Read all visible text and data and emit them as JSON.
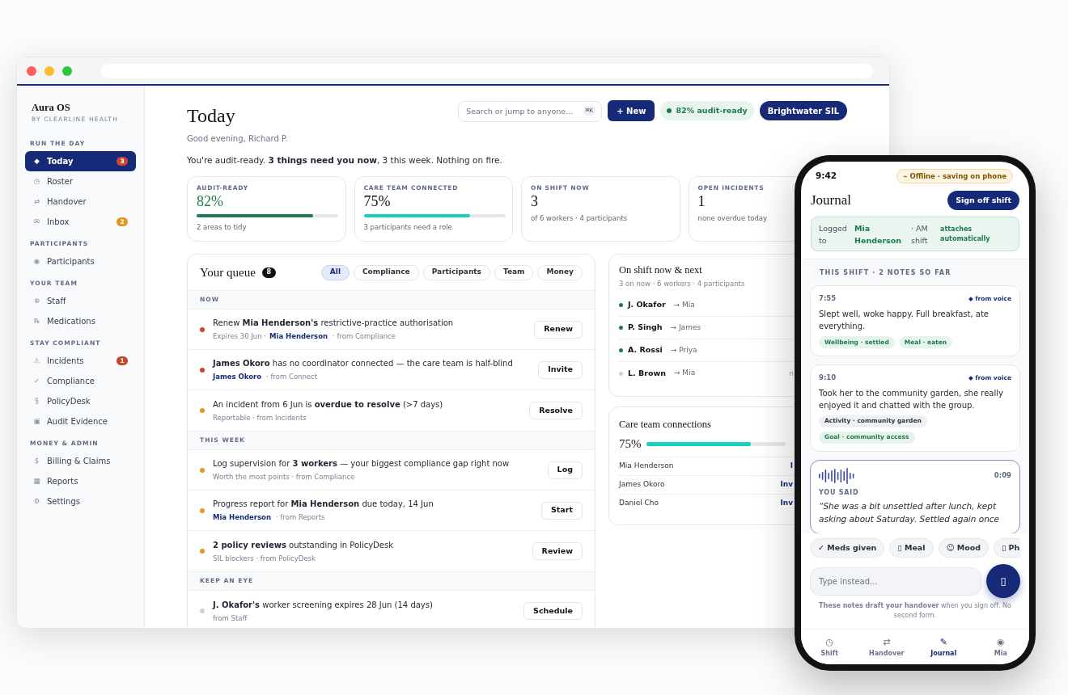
{
  "sidebar": {
    "brand": "Aura OS",
    "subtitle": "BY CLEARLINE HEALTH",
    "sections": [
      {
        "heading": "RUN THE DAY",
        "items": [
          {
            "icon": "◆",
            "label": "Today",
            "selected": true,
            "badge": "3",
            "color": "#c8472f"
          },
          {
            "icon": "◷",
            "label": "Roster",
            "selected": false
          },
          {
            "icon": "⇄",
            "label": "Handover",
            "selected": false
          },
          {
            "icon": "✉",
            "label": "Inbox",
            "selected": false,
            "badge": "2",
            "color": "#dc9a22"
          }
        ]
      },
      {
        "heading": "PARTICIPANTS",
        "items": [
          {
            "icon": "◉",
            "label": "Participants",
            "selected": false
          }
        ]
      },
      {
        "heading": "YOUR TEAM",
        "items": [
          {
            "icon": "⊕",
            "label": "Staff",
            "selected": false
          },
          {
            "icon": "℞",
            "label": "Medications",
            "selected": false
          }
        ]
      },
      {
        "heading": "STAY COMPLIANT",
        "items": [
          {
            "icon": "⚠",
            "label": "Incidents",
            "selected": false,
            "badge": "1",
            "color": "#c8472f"
          },
          {
            "icon": "✓",
            "label": "Compliance",
            "selected": false
          },
          {
            "icon": "§",
            "label": "PolicyDesk",
            "selected": false
          },
          {
            "icon": "▣",
            "label": "Audit Evidence",
            "selected": false
          }
        ]
      },
      {
        "heading": "MONEY & ADMIN",
        "items": [
          {
            "icon": "$",
            "label": "Billing & Claims",
            "selected": false
          },
          {
            "icon": "▦",
            "label": "Reports",
            "selected": false
          },
          {
            "icon": "⚙",
            "label": "Settings",
            "selected": false
          }
        ]
      }
    ]
  },
  "header": {
    "title": "Today",
    "greeting": "Good evening, Richard P.",
    "summary": "You're audit-ready. **3 things need you now**, 3 this week. Nothing on fire.",
    "search": {
      "placeholder": "Search or jump to anyone...",
      "shortcut": "⌘K"
    },
    "new_button": "+ New",
    "audit_status": "82% audit-ready",
    "org_button": "Brightwater SIL"
  },
  "stats": [
    {
      "label": "AUDIT-READY",
      "value": "82%",
      "highlight": true,
      "level": 0.82,
      "color": "#1e7a4f",
      "note": "2 areas to tidy"
    },
    {
      "label": "CARE TEAM CONNECTED",
      "value": "75%",
      "highlight": false,
      "level": 0.75,
      "color": "#14d3b8",
      "note": "3 participants need a role"
    },
    {
      "label": "ON SHIFT NOW",
      "value": "3",
      "highlight": false,
      "note": "of 6 workers · 4 participants"
    },
    {
      "label": "OPEN INCIDENTS",
      "value": "1",
      "highlight": false,
      "note": "none overdue today"
    }
  ],
  "queue": {
    "title": "Your queue",
    "count": "8",
    "filters": [
      {
        "label": "All",
        "selected": true
      },
      {
        "label": "Compliance",
        "selected": false
      },
      {
        "label": "Participants",
        "selected": false
      },
      {
        "label": "Team",
        "selected": false
      },
      {
        "label": "Money",
        "selected": false
      }
    ],
    "groups": [
      {
        "heading": "NOW",
        "items": [
          {
            "color": "#c8472f",
            "title": "Renew **Mia Henderson's** restrictive-practice authorisation",
            "meta": "Expires 30 Jun ·",
            "link": "Mia Henderson",
            "source": "· from Compliance",
            "action": "Renew"
          },
          {
            "color": "#c8472f",
            "title": "**James Okoro** has no coordinator connected — the care team is half-blind",
            "link": "James Okoro",
            "source": "· from Connect",
            "action": "Invite"
          },
          {
            "color": "#e09a2b",
            "title": "An incident from 6 Jun is **overdue to resolve** (>7 days)",
            "source": "Reportable · from Incidents",
            "action": "Resolve"
          }
        ]
      },
      {
        "heading": "THIS WEEK",
        "items": [
          {
            "color": "#e09a2b",
            "title": "Log supervision for **3 workers** — your biggest compliance gap right now",
            "source": "Worth the most points · from Compliance",
            "action": "Log"
          },
          {
            "color": "#e09a2b",
            "title": "Progress report for **Mia Henderson** due today, 14 Jun",
            "link": "Mia Henderson",
            "source": "· from Reports",
            "action": "Start"
          },
          {
            "color": "#e09a2b",
            "title": "**2 policy reviews** outstanding in PolicyDesk",
            "source": "SIL blockers · from PolicyDesk",
            "action": "Review"
          }
        ]
      },
      {
        "heading": "KEEP AN EYE",
        "items": [
          {
            "color": "#cdd1d8",
            "title": "**J. Okafor's** worker screening expires 28 Jun (14 days)",
            "source": "from Staff",
            "action": "Schedule"
          }
        ]
      }
    ]
  },
  "shifts": {
    "title": "On shift now & next",
    "summary": "3 on now · 6 workers · 4 participants",
    "rows": [
      {
        "worker": "J. Okafor",
        "participant": "→ Mia",
        "on_shift": true
      },
      {
        "worker": "P. Singh",
        "participant": "→ James",
        "on_shift": true
      },
      {
        "worker": "A. Rossi",
        "participant": "→ Priya",
        "on_shift": true
      },
      {
        "worker": "L. Brown",
        "participant": "→ Mia",
        "on_shift": false,
        "note": "n"
      }
    ]
  },
  "connections": {
    "title": "Care team connections",
    "value": "75%",
    "level": 0.75,
    "rows": [
      {
        "name": "Mia Henderson",
        "action": "I"
      },
      {
        "name": "James Okoro",
        "action": "Inv"
      },
      {
        "name": "Daniel Cho",
        "action": "Inv"
      }
    ]
  },
  "phone": {
    "time": "9:42",
    "status": "⌁ Offline · saving on phone",
    "title": "Journal",
    "sign_off": "Sign off shift",
    "logged": {
      "label": "Logged to",
      "participant": "Mia Henderson",
      "shift": "· AM shift",
      "note": "attaches automatically"
    },
    "notes_heading": "THIS SHIFT · 2 NOTES SO FAR",
    "notes": [
      {
        "time": "7:55",
        "source": "◆ from voice",
        "text": "Slept well, woke happy. Full breakfast, ate everything.",
        "tags": [
          {
            "label": "Wellbeing · settled",
            "kind": "outcome"
          },
          {
            "label": "Meal · eaten",
            "kind": "outcome"
          }
        ]
      },
      {
        "time": "9:10",
        "source": "◆ from voice",
        "text": "Took her to the community garden, she really enjoyed it and chatted with the group.",
        "tags": [
          {
            "label": "Activity · community garden",
            "kind": "activity"
          },
          {
            "label": "Goal · community access",
            "kind": "outcome"
          }
        ]
      }
    ],
    "voice": {
      "duration": "0:09",
      "label": "YOU SAID",
      "quote": "“She was a bit unsettled after lunch, kept asking about Saturday. Settled again once"
    },
    "chips": [
      "✓ Meds given",
      "▯ Meal",
      "☺ Mood",
      "▯ Ph"
    ],
    "input": {
      "placeholder": "Type instead..."
    },
    "mic": "▯",
    "footer": "**These notes draft your handover** when you sign off. No second form.",
    "nav": [
      {
        "icon": "◷",
        "label": "Shift",
        "selected": false
      },
      {
        "icon": "⇄",
        "label": "Handover",
        "selected": false
      },
      {
        "icon": "✎",
        "label": "Journal",
        "selected": true
      },
      {
        "icon": "◉",
        "label": "Mia",
        "selected": false
      }
    ]
  }
}
